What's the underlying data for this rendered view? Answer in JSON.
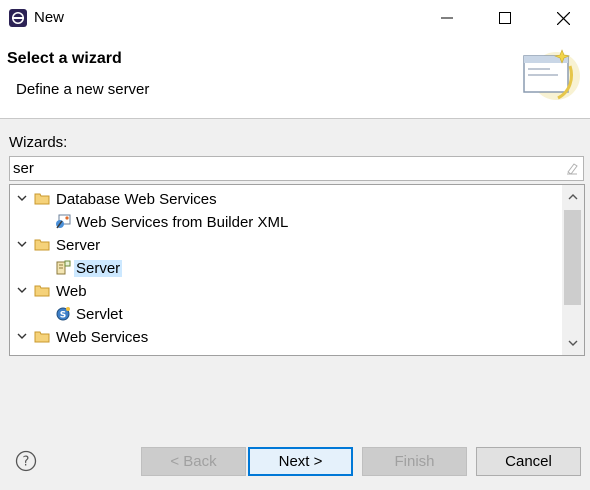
{
  "window": {
    "title": "New",
    "icon": "eclipse-icon"
  },
  "banner": {
    "heading": "Select a wizard",
    "description": "Define a new server",
    "image": "wizard-banner-icon"
  },
  "wizards": {
    "label": "Wizards:",
    "filter_value": "ser",
    "clear_icon": "clear-filter-icon"
  },
  "tree": [
    {
      "label": "Database Web Services",
      "icon": "folder-icon",
      "expanded": true
    },
    {
      "label": "Web Services from Builder XML",
      "icon": "web-service-builder-icon"
    },
    {
      "label": "Server",
      "icon": "folder-icon",
      "expanded": true
    },
    {
      "label": "Server",
      "icon": "server-icon",
      "selected": true
    },
    {
      "label": "Web",
      "icon": "folder-icon",
      "expanded": true
    },
    {
      "label": "Servlet",
      "icon": "servlet-icon"
    },
    {
      "label": "Web Services",
      "icon": "folder-icon",
      "expanded": true
    }
  ],
  "buttons": {
    "help_icon": "help-icon",
    "back": "< Back",
    "next": "Next >",
    "finish": "Finish",
    "cancel": "Cancel"
  },
  "colors": {
    "selection": "#cce8ff",
    "default_button_border": "#0078d7",
    "folder": "#e8b84a"
  }
}
